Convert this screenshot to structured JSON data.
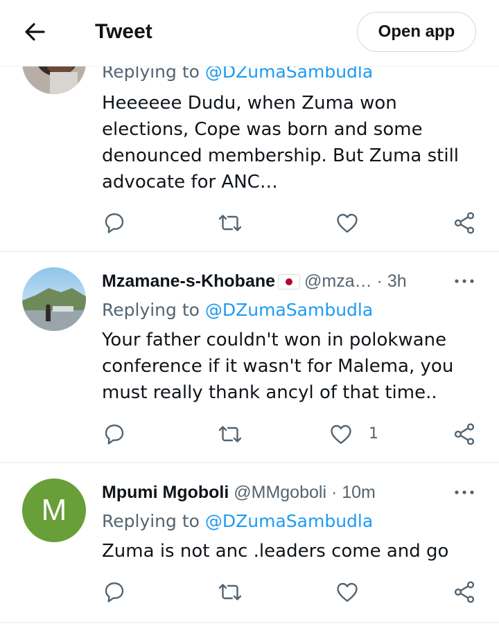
{
  "header": {
    "title": "Tweet",
    "open_app_label": "Open app"
  },
  "tweets": [
    {
      "replying_prefix": "Replying to",
      "replying_to": "@DZumaSambudla",
      "text": "Heeeeee Dudu, when Zuma won elections, Cope was born and some denounced membership. But Zuma still advocate for ANC…",
      "likes": ""
    },
    {
      "display_name": "Mzamane-s-Khobane",
      "flag": "japan-flag",
      "handle": "@mza…",
      "separator": "·",
      "time": "3h",
      "replying_prefix": "Replying to",
      "replying_to": "@DZumaSambudla",
      "text": "Your father couldn't won in polokwane conference if it wasn't for Malema, you must really thank ancyl of that time..",
      "likes": "1"
    },
    {
      "avatar_letter": "M",
      "avatar_color": "#689f38",
      "display_name": "Mpumi Mgoboli",
      "handle": "@MMgoboli",
      "separator": "·",
      "time": "10m",
      "replying_prefix": "Replying to",
      "replying_to": "@DZumaSambudla",
      "text": "Zuma is not anc .leaders come and go",
      "likes": ""
    }
  ],
  "colors": {
    "accent": "#1d9bf0",
    "secondary_text": "#536471",
    "icon": "#536471"
  }
}
